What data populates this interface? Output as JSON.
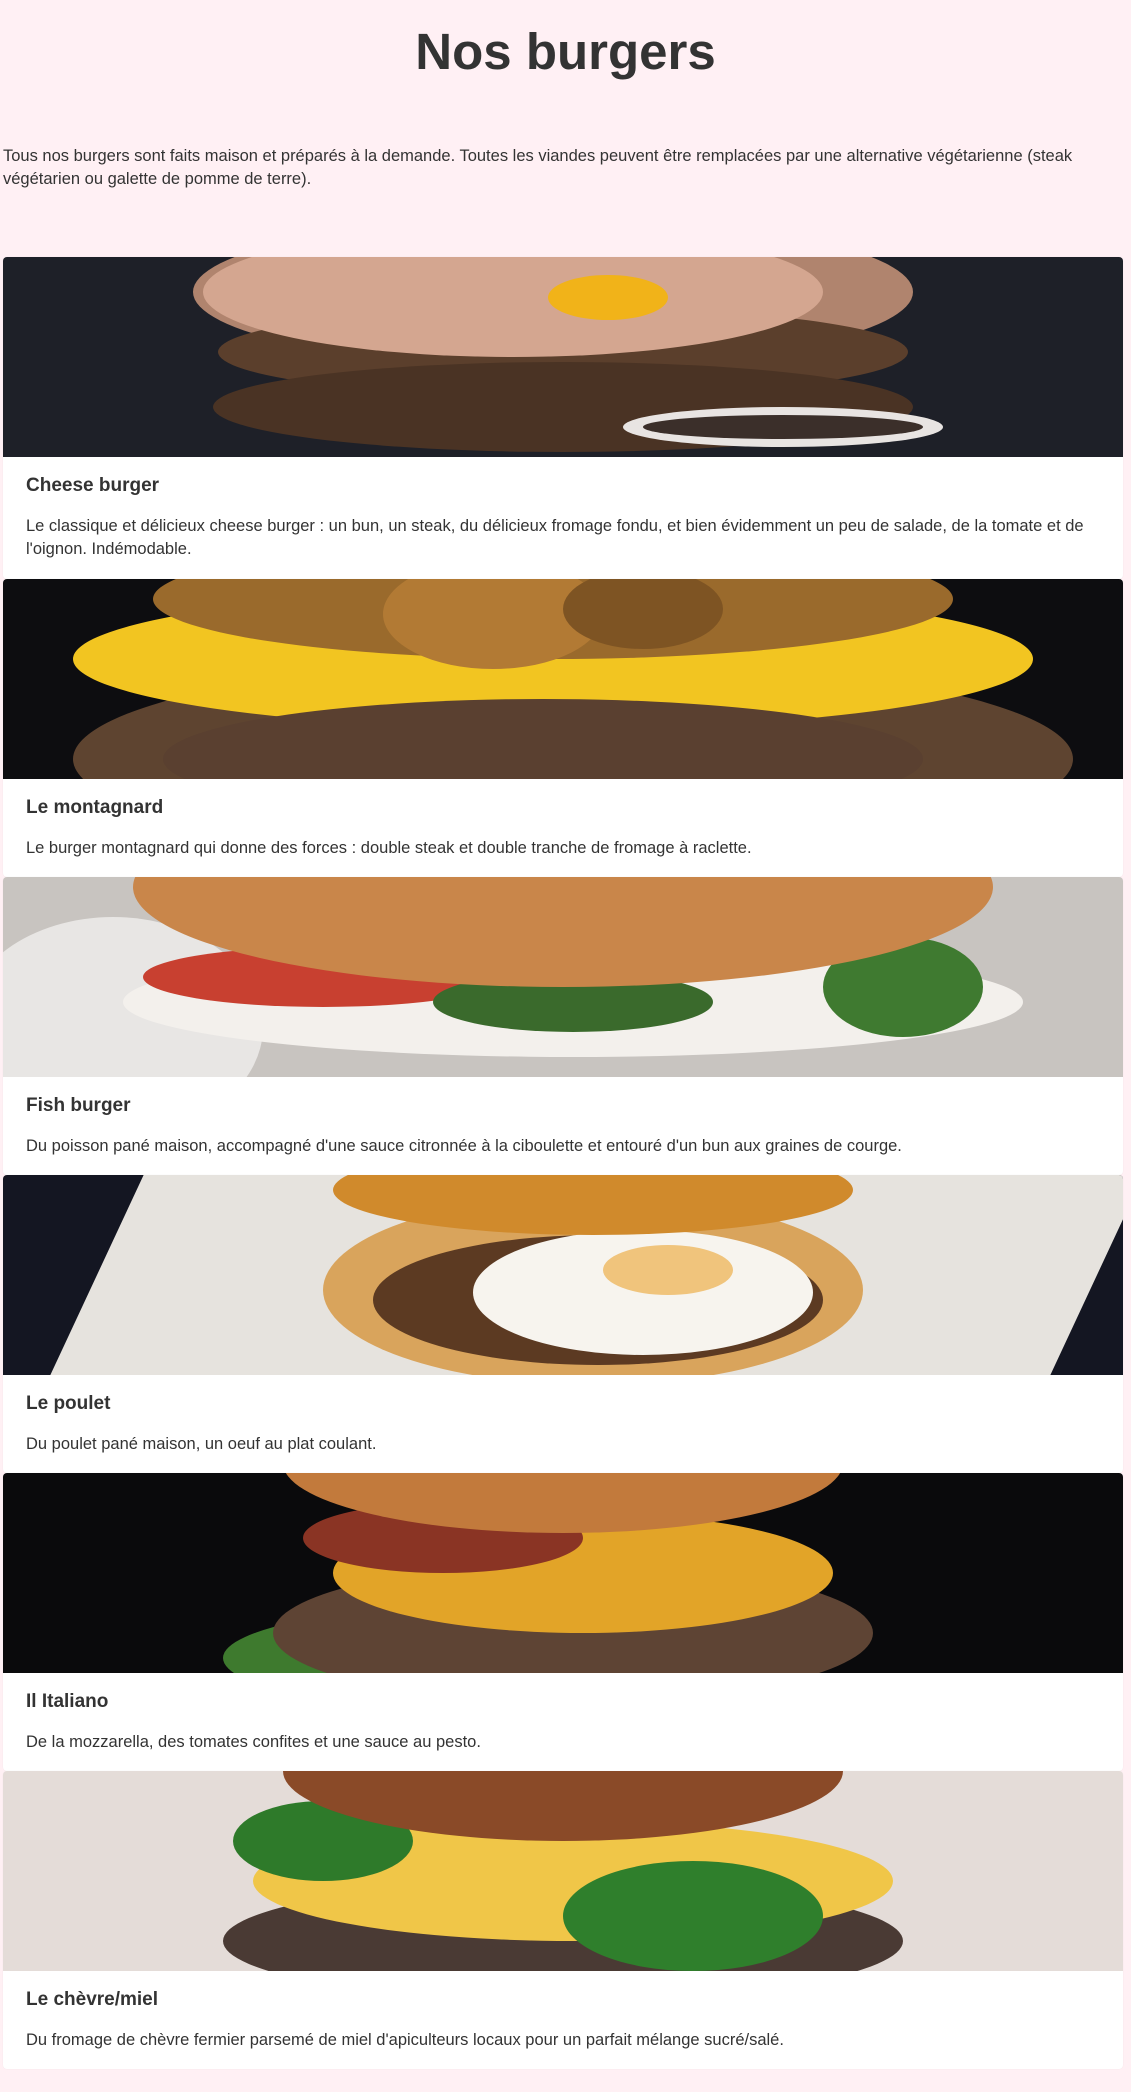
{
  "page": {
    "title": "Nos burgers",
    "intro": "Tous nos burgers sont faits maison et préparés à la demande. Toutes les viandes peuvent être remplacées par une alternative végétarienne (steak végétarien ou galette de pomme de terre)."
  },
  "burgers": [
    {
      "name": "Cheese burger",
      "description": "Le classique et délicieux cheese burger : un bun, un steak, du délicieux fromage fondu, et bien évidemment un peu de salade, de la tomate et de l'oignon. Indémodable.",
      "image": "cheese-burger-photo"
    },
    {
      "name": "Le montagnard",
      "description": "Le burger montagnard qui donne des forces : double steak et double tranche de fromage à raclette.",
      "image": "montagnard-burger-photo"
    },
    {
      "name": "Fish burger",
      "description": "Du poisson pané maison, accompagné d'une sauce citronnée à la ciboulette et entouré d'un bun aux graines de courge.",
      "image": "fish-burger-photo"
    },
    {
      "name": "Le poulet",
      "description": "Du poulet pané maison, un oeuf au plat coulant.",
      "image": "chicken-burger-photo"
    },
    {
      "name": "Il Italiano",
      "description": "De la mozzarella, des tomates confites et une sauce au pesto.",
      "image": "italiano-burger-photo"
    },
    {
      "name": "Le chèvre/miel",
      "description": "Du fromage de chèvre fermier parsemé de miel d'apiculteurs locaux pour un parfait mélange sucré/salé.",
      "image": "goat-honey-burger-photo"
    }
  ],
  "colors": {
    "background": "#fff0f4",
    "card": "#ffffff",
    "text": "#333333"
  }
}
